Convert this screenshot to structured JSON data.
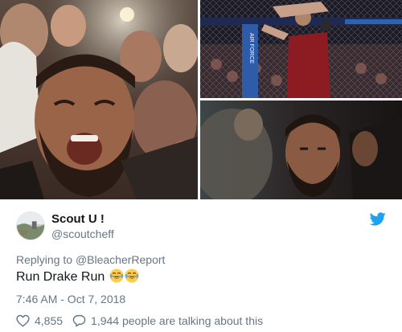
{
  "photos": {
    "left": {
      "alt": ""
    },
    "top_right": {
      "banner_text": "AIR FORCE"
    },
    "bottom_right": {
      "alt": ""
    }
  },
  "tweet": {
    "display_name": "Scout U !",
    "handle": "@scoutcheff",
    "replying_prefix": "Replying to ",
    "replying_to": "@BleacherReport",
    "text": "Run Drake Run",
    "emojis": [
      "face-with-tears-of-joy",
      "face-with-tears-of-joy"
    ],
    "timestamp": "7:46 AM - Oct 7, 2018",
    "like_count": "4,855",
    "talking_text": "1,944 people are talking about this"
  },
  "icons": {
    "brand": "twitter-bird-icon",
    "like": "heart-icon",
    "reply": "speech-bubble-icon"
  },
  "colors": {
    "brand_blue": "#1da1f2",
    "name_text": "#14171a",
    "secondary_text": "#657786"
  }
}
